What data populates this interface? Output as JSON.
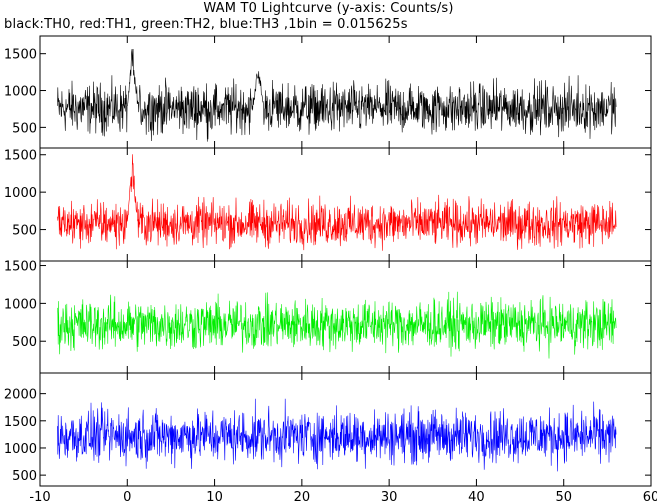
{
  "title": "WAM T0 Lightcurve (y-axis: Counts/s)",
  "subtitle": "black:TH0, red:TH1, green:TH2, blue:TH3 ,1bin = 0.015625s",
  "chart_data": {
    "type": "line",
    "title": "WAM T0 Lightcurve (y-axis: Counts/s)",
    "subtitle": "black:TH0, red:TH1, green:TH2, blue:TH3 ,1bin = 0.015625s",
    "xlabel": "",
    "ylabel": "Counts/s",
    "bin_size_s": 0.015625,
    "xlim": [
      -10,
      60
    ],
    "x_ticks": [
      -10,
      0,
      10,
      20,
      30,
      40,
      50,
      60
    ],
    "data_x_range": [
      -8,
      56
    ],
    "panels": [
      {
        "name": "TH0",
        "color": "#000000",
        "ylim": [
          220,
          1740
        ],
        "y_ticks": [
          500,
          1000,
          1500
        ],
        "mean": 760,
        "spread": 175,
        "bursts": [
          {
            "x": 0.6,
            "peak": 1700
          },
          {
            "x": 15.0,
            "peak": 1460
          }
        ]
      },
      {
        "name": "TH1",
        "color": "#ff0000",
        "ylim": [
          80,
          1590
        ],
        "y_ticks": [
          500,
          1000,
          1500
        ],
        "mean": 580,
        "spread": 155,
        "bursts": [
          {
            "x": 0.6,
            "peak": 1560
          }
        ]
      },
      {
        "name": "TH2",
        "color": "#00ee00",
        "ylim": [
          80,
          1560
        ],
        "y_ticks": [
          500,
          1000,
          1500
        ],
        "mean": 720,
        "spread": 170,
        "bursts": []
      },
      {
        "name": "TH3",
        "color": "#0000ff",
        "ylim": [
          300,
          2380
        ],
        "y_ticks": [
          500,
          1000,
          1500,
          2000
        ],
        "mean": 1220,
        "spread": 250,
        "bursts": []
      }
    ]
  }
}
